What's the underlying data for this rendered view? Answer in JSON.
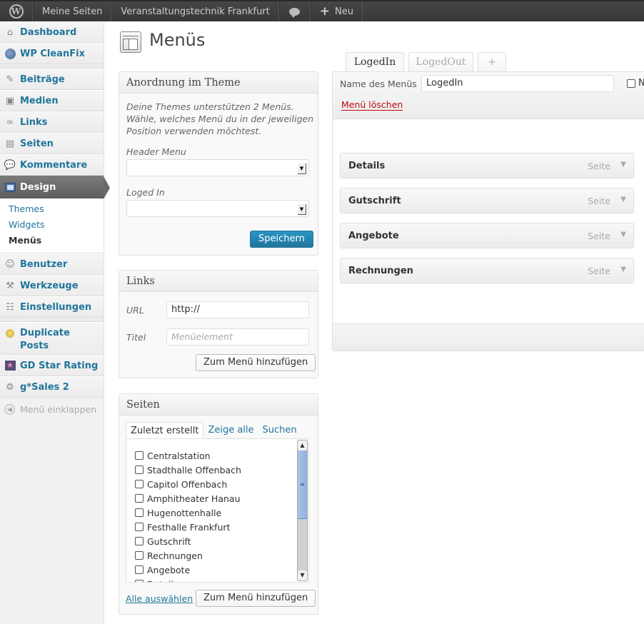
{
  "adminbar": {
    "wp_logo": "W",
    "items": [
      "Meine Seiten",
      "Veranstaltungstechnik Frankfurt"
    ],
    "new_label": "Neu"
  },
  "sidebar": {
    "items": [
      {
        "label": "Dashboard",
        "icon": "home-icon"
      },
      {
        "label": "WP CleanFix",
        "icon": "globe-icon"
      },
      {
        "label": "Beiträge",
        "icon": "pin-icon"
      },
      {
        "label": "Medien",
        "icon": "media-icon"
      },
      {
        "label": "Links",
        "icon": "link-icon"
      },
      {
        "label": "Seiten",
        "icon": "pages-icon"
      },
      {
        "label": "Kommentare",
        "icon": "comment-icon"
      },
      {
        "label": "Design",
        "icon": "design-icon"
      },
      {
        "label": "Benutzer",
        "icon": "users-icon"
      },
      {
        "label": "Werkzeuge",
        "icon": "tools-icon"
      },
      {
        "label": "Einstellungen",
        "icon": "settings-icon"
      },
      {
        "label": "Duplicate Posts",
        "icon": "duplicate-icon"
      },
      {
        "label": "GD Star Rating",
        "icon": "star-icon"
      },
      {
        "label": "g*Sales 2",
        "icon": "gear-icon"
      }
    ],
    "design_submenu": [
      "Themes",
      "Widgets",
      "Menüs"
    ],
    "collapse_label": "Menü einklappen"
  },
  "page": {
    "title": "Menüs"
  },
  "theme_locations": {
    "title": "Anordnung im Theme",
    "description": "Deine Themes unterstützen 2 Menüs. Wähle, welches Menü du in der jeweiligen Position verwenden möchtest.",
    "locations": [
      {
        "label": "Header Menu",
        "value": ""
      },
      {
        "label": "Loged In",
        "value": ""
      }
    ],
    "save_label": "Speichern"
  },
  "links_box": {
    "title": "Links",
    "url_label": "URL",
    "url_value": "http://",
    "title_label": "Titel",
    "title_placeholder": "Menüelement",
    "add_label": "Zum Menü hinzufügen"
  },
  "pages_box": {
    "title": "Seiten",
    "tabs": [
      "Zuletzt erstellt",
      "Zeige alle",
      "Suchen"
    ],
    "pages": [
      "Centralstation",
      "Stadthalle Offenbach",
      "Capitol Offenbach",
      "Amphitheater Hanau",
      "Hugenottenhalle",
      "Festhalle Frankfurt",
      "Gutschrift",
      "Rechnungen",
      "Angebote",
      "Details"
    ],
    "select_all_label": "Alle auswählen",
    "add_label": "Zum Menü hinzufügen"
  },
  "menu_tabs": [
    "LogedIn",
    "LogedOut",
    "+"
  ],
  "menu_editor": {
    "name_label": "Name des Menüs",
    "name_value": "LogedIn",
    "auto_add_label": "N",
    "delete_label": "Menü löschen",
    "items": [
      {
        "title": "Details",
        "type": "Seite"
      },
      {
        "title": "Gutschrift",
        "type": "Seite"
      },
      {
        "title": "Angebote",
        "type": "Seite"
      },
      {
        "title": "Rechnungen",
        "type": "Seite"
      }
    ]
  },
  "colors": {
    "link": "#21759b",
    "delete": "#bc0b0b",
    "primary_button": "#21759b"
  }
}
